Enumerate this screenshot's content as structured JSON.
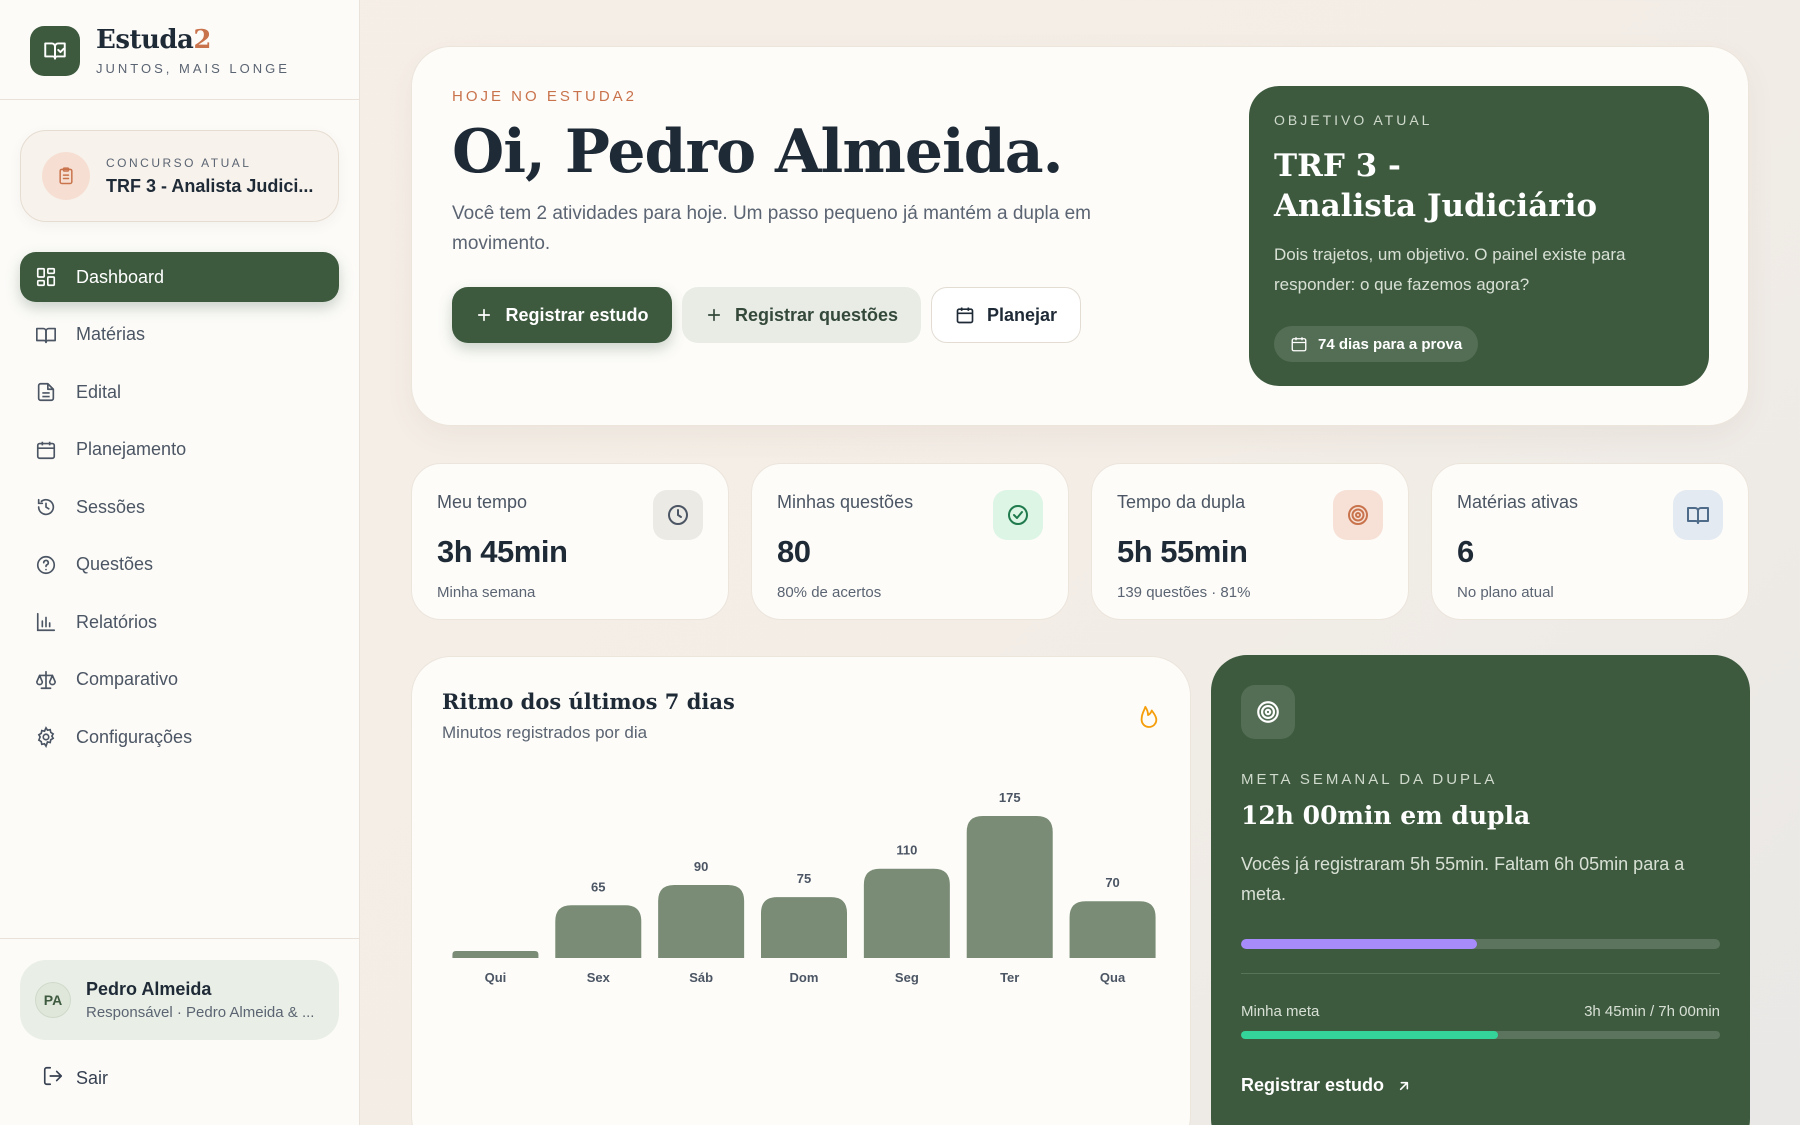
{
  "brand": {
    "name_main": "Estuda",
    "name_accent": "2",
    "tagline": "JUNTOS, MAIS LONGE"
  },
  "contest": {
    "label": "CONCURSO ATUAL",
    "value": "TRF 3 - Analista Judici..."
  },
  "nav": [
    {
      "label": "Dashboard",
      "icon": "grid-icon",
      "active": true
    },
    {
      "label": "Matérias",
      "icon": "book-icon"
    },
    {
      "label": "Edital",
      "icon": "document-icon"
    },
    {
      "label": "Planejamento",
      "icon": "calendar-icon"
    },
    {
      "label": "Sessões",
      "icon": "timer-icon"
    },
    {
      "label": "Questões",
      "icon": "question-icon"
    },
    {
      "label": "Relatórios",
      "icon": "bar-chart-icon"
    },
    {
      "label": "Comparativo",
      "icon": "scale-icon"
    },
    {
      "label": "Configurações",
      "icon": "gear-icon"
    }
  ],
  "user": {
    "initials": "PA",
    "name": "Pedro Almeida",
    "role": "Responsável · Pedro Almeida & ..."
  },
  "logout": "Sair",
  "hero": {
    "eyebrow": "HOJE NO ESTUDA2",
    "title": "Oi, Pedro Almeida.",
    "subtitle": "Você tem 2 atividades para hoje. Um passo pequeno já mantém a dupla em movimento.",
    "buttons": {
      "study": "Registrar estudo",
      "questions": "Registrar questões",
      "plan": "Planejar"
    }
  },
  "goal": {
    "label": "OBJETIVO ATUAL",
    "title_line1": "TRF 3 -",
    "title_line2": "Analista Judiciário",
    "description": "Dois trajetos, um objetivo. O painel existe para responder: o que fazemos agora?",
    "days": "74 dias para a prova"
  },
  "stats": [
    {
      "label": "Meu tempo",
      "value": "3h 45min",
      "sub": "Minha semana",
      "icon": "clock-icon"
    },
    {
      "label": "Minhas questões",
      "value": "80",
      "sub": "80% de acertos",
      "icon": "check-circle-icon"
    },
    {
      "label": "Tempo da dupla",
      "value": "5h 55min",
      "sub": "139 questões · 81%",
      "icon": "target-icon"
    },
    {
      "label": "Matérias ativas",
      "value": "6",
      "sub": "No plano atual",
      "icon": "book-open-icon"
    }
  ],
  "chart_data": {
    "type": "bar",
    "title": "Ritmo dos últimos 7 dias",
    "subtitle": "Minutos registrados por dia",
    "categories": [
      "Qui",
      "Sex",
      "Sáb",
      "Dom",
      "Seg",
      "Ter",
      "Qua"
    ],
    "values": [
      0,
      65,
      90,
      75,
      110,
      175,
      70
    ],
    "labels": [
      "",
      "65",
      "90",
      "75",
      "110",
      "175",
      "70"
    ],
    "ylim": [
      0,
      175
    ],
    "grid": false,
    "color": "#7a8c75"
  },
  "weekly": {
    "label": "META SEMANAL DA DUPLA",
    "title": "12h 00min em dupla",
    "description": "Vocês já registraram 5h 55min. Faltam 6h 05min para a meta.",
    "pair_progress": 0.493,
    "pair_color": "#a78bfa",
    "my_label": "Minha meta",
    "my_value": "3h 45min / 7h 00min",
    "my_progress": 0.536,
    "my_color": "#34d399",
    "link": "Registrar estudo"
  },
  "colors": {
    "primary": "#3d5a3e",
    "accent": "#c9734c",
    "bar": "#7a8c75"
  }
}
